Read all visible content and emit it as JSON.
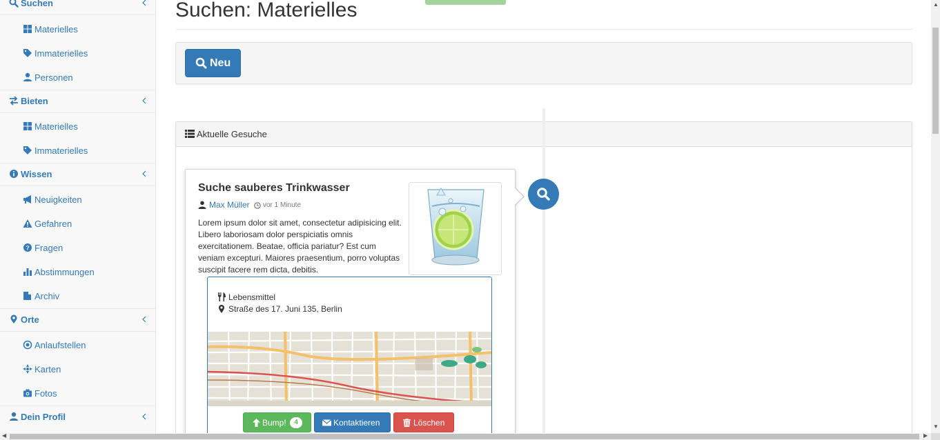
{
  "colors": {
    "primary": "#337ab7",
    "success": "#5cb85c",
    "danger": "#d9534f",
    "sidebar_bg": "#f8f8f8"
  },
  "sidebar": {
    "sections": [
      {
        "label": "Suchen",
        "icon": "search-icon",
        "items": [
          {
            "label": "Materielles",
            "icon": "th-large-icon"
          },
          {
            "label": "Immaterielles",
            "icon": "tags-icon"
          },
          {
            "label": "Personen",
            "icon": "user-icon"
          }
        ]
      },
      {
        "label": "Bieten",
        "icon": "exchange-icon",
        "items": [
          {
            "label": "Materielles",
            "icon": "th-large-icon"
          },
          {
            "label": "Immaterielles",
            "icon": "tags-icon"
          }
        ]
      },
      {
        "label": "Wissen",
        "icon": "info-circle-icon",
        "items": [
          {
            "label": "Neuigkeiten",
            "icon": "bullhorn-icon"
          },
          {
            "label": "Gefahren",
            "icon": "warning-icon"
          },
          {
            "label": "Fragen",
            "icon": "question-circle-icon"
          },
          {
            "label": "Abstimmungen",
            "icon": "bar-chart-icon"
          },
          {
            "label": "Archiv",
            "icon": "archive-icon"
          }
        ]
      },
      {
        "label": "Orte",
        "icon": "map-marker-icon",
        "items": [
          {
            "label": "Anlaufstellen",
            "icon": "dot-circle-icon"
          },
          {
            "label": "Karten",
            "icon": "crosshairs-icon"
          },
          {
            "label": "Fotos",
            "icon": "camera-icon"
          }
        ]
      },
      {
        "label": "Dein Profil",
        "icon": "user-icon",
        "items": []
      }
    ]
  },
  "header": {
    "title": "Suchen: Materielles"
  },
  "toolbar": {
    "new_label": "Neu"
  },
  "panel": {
    "title": "Aktuelle Gesuche"
  },
  "post": {
    "title": "Suche sauberes Trinkwasser",
    "author": "Max Müller",
    "time": "vor 1 Minute",
    "body": "Lorem ipsum dolor sit amet, consectetur adipisicing elit. Libero laboriosam dolor perspiciatis omnis exercitationem. Beatae, officia pariatur? Est cum veniam excepturi. Maiores praesentium, porro voluptas suscipit facere rem dicta, debitis.",
    "category": "Lebensmittel",
    "address": "Straße des 17. Juni 135, Berlin",
    "actions": {
      "bump_label": "Bump!",
      "bump_count": "4",
      "contact_label": "Kontaktieren",
      "delete_label": "Löschen"
    }
  }
}
